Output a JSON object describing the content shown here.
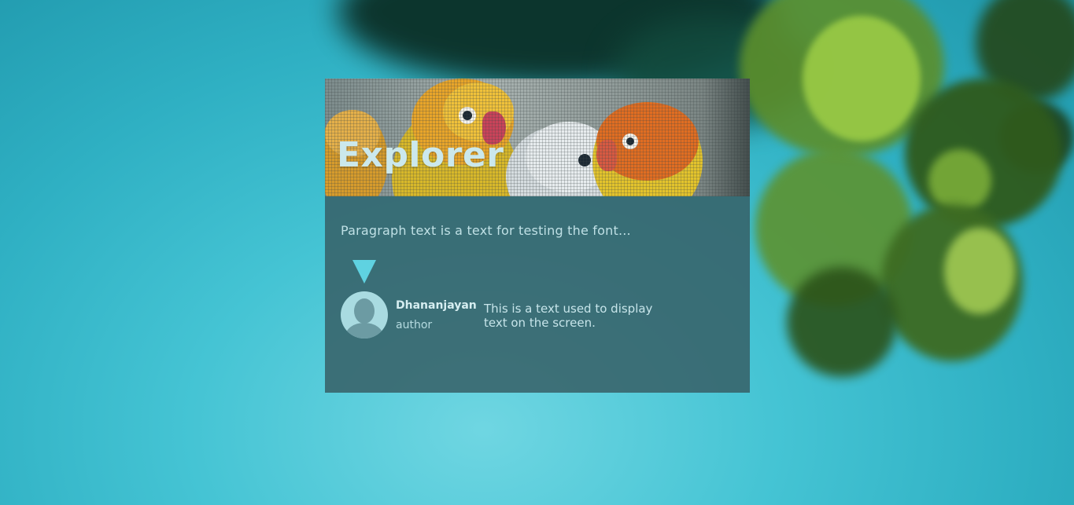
{
  "card": {
    "title": "Explorer",
    "paragraph": "Paragraph text is a text for testing the font...",
    "author": {
      "name": "Dhananjayan",
      "role": "author",
      "quote": "This is a text used to display text on the screen."
    }
  },
  "icons": {
    "pointer": "triangle-down-icon",
    "avatar": "user-avatar-icon"
  },
  "colors": {
    "background": "#3fbfd0",
    "card_overlay": "#375f67",
    "accent": "#5fd2e1",
    "title": "#cbe8ec"
  }
}
